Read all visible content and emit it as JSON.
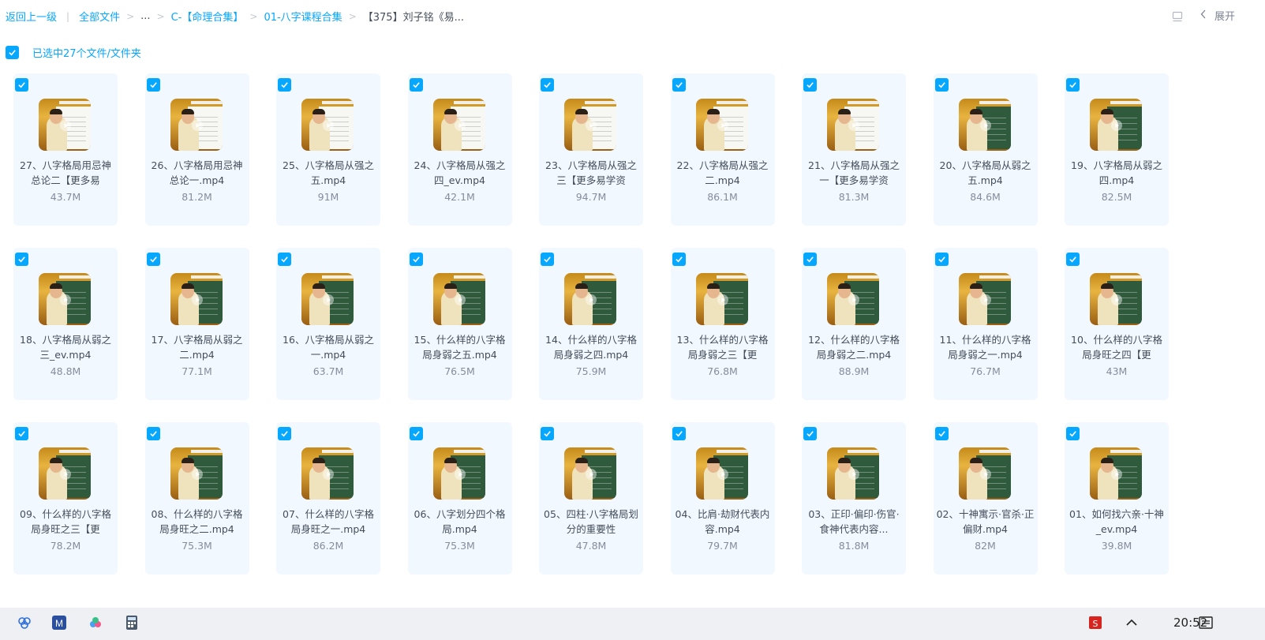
{
  "breadcrumb": {
    "back": "返回上一级",
    "all_files": "全部文件",
    "ellipsis": "...",
    "c_folder": "C-【命理合集】",
    "bazi_folder": "01-八字课程合集",
    "current": "【375】刘子铭《易..."
  },
  "toolbar": {
    "expand_label": "展开"
  },
  "selection": {
    "label": "已选中27个文件/文件夹",
    "checked": true
  },
  "files": [
    {
      "name": "27、八字格局用忌神总论二【更多易",
      "size": "43.7M",
      "board": "white"
    },
    {
      "name": "26、八字格局用忌神总论一.mp4",
      "size": "81.2M",
      "board": "white"
    },
    {
      "name": "25、八字格局从强之五.mp4",
      "size": "91M",
      "board": "white"
    },
    {
      "name": "24、八字格局从强之四_ev.mp4",
      "size": "42.1M",
      "board": "white"
    },
    {
      "name": "23、八字格局从强之三【更多易学资",
      "size": "94.7M",
      "board": "white"
    },
    {
      "name": "22、八字格局从强之二.mp4",
      "size": "86.1M",
      "board": "white"
    },
    {
      "name": "21、八字格局从强之一【更多易学资",
      "size": "81.3M",
      "board": "white"
    },
    {
      "name": "20、八字格局从弱之五.mp4",
      "size": "84.6M",
      "board": "green"
    },
    {
      "name": "19、八字格局从弱之四.mp4",
      "size": "82.5M",
      "board": "green"
    },
    {
      "name": "18、八字格局从弱之三_ev.mp4",
      "size": "48.8M",
      "board": "green"
    },
    {
      "name": "17、八字格局从弱之二.mp4",
      "size": "77.1M",
      "board": "green"
    },
    {
      "name": "16、八字格局从弱之一.mp4",
      "size": "63.7M",
      "board": "green"
    },
    {
      "name": "15、什么样的八字格局身弱之五.mp4",
      "size": "76.5M",
      "board": "green"
    },
    {
      "name": "14、什么样的八字格局身弱之四.mp4",
      "size": "75.9M",
      "board": "green"
    },
    {
      "name": "13、什么样的八字格局身弱之三【更",
      "size": "76.8M",
      "board": "green"
    },
    {
      "name": "12、什么样的八字格局身弱之二.mp4",
      "size": "88.9M",
      "board": "green"
    },
    {
      "name": "11、什么样的八字格局身弱之一.mp4",
      "size": "76.7M",
      "board": "green"
    },
    {
      "name": "10、什么样的八字格局身旺之四【更",
      "size": "43M",
      "board": "green"
    },
    {
      "name": "09、什么样的八字格局身旺之三【更",
      "size": "78.2M",
      "board": "green"
    },
    {
      "name": "08、什么样的八字格局身旺之二.mp4",
      "size": "75.3M",
      "board": "green"
    },
    {
      "name": "07、什么样的八字格局身旺之一.mp4",
      "size": "86.2M",
      "board": "green"
    },
    {
      "name": "06、八字划分四个格局.mp4",
      "size": "75.3M",
      "board": "green"
    },
    {
      "name": "05、四柱·八字格局划分的重要性",
      "size": "47.8M",
      "board": "green"
    },
    {
      "name": "04、比肩·劫财代表内容.mp4",
      "size": "79.7M",
      "board": "green"
    },
    {
      "name": "03、正印·偏印·伤官·食神代表内容...",
      "size": "81.8M",
      "board": "green"
    },
    {
      "name": "02、十神寓示·官杀·正偏财.mp4",
      "size": "82M",
      "board": "green"
    },
    {
      "name": "01、如何找六亲·十神_ev.mp4",
      "size": "39.8M",
      "board": "green"
    }
  ],
  "taskbar": {
    "time": "20:52"
  },
  "colors": {
    "accent": "#06a7ff",
    "card_bg": "#f1f8ff",
    "text": "#454d5a",
    "muted": "#878c9c"
  }
}
